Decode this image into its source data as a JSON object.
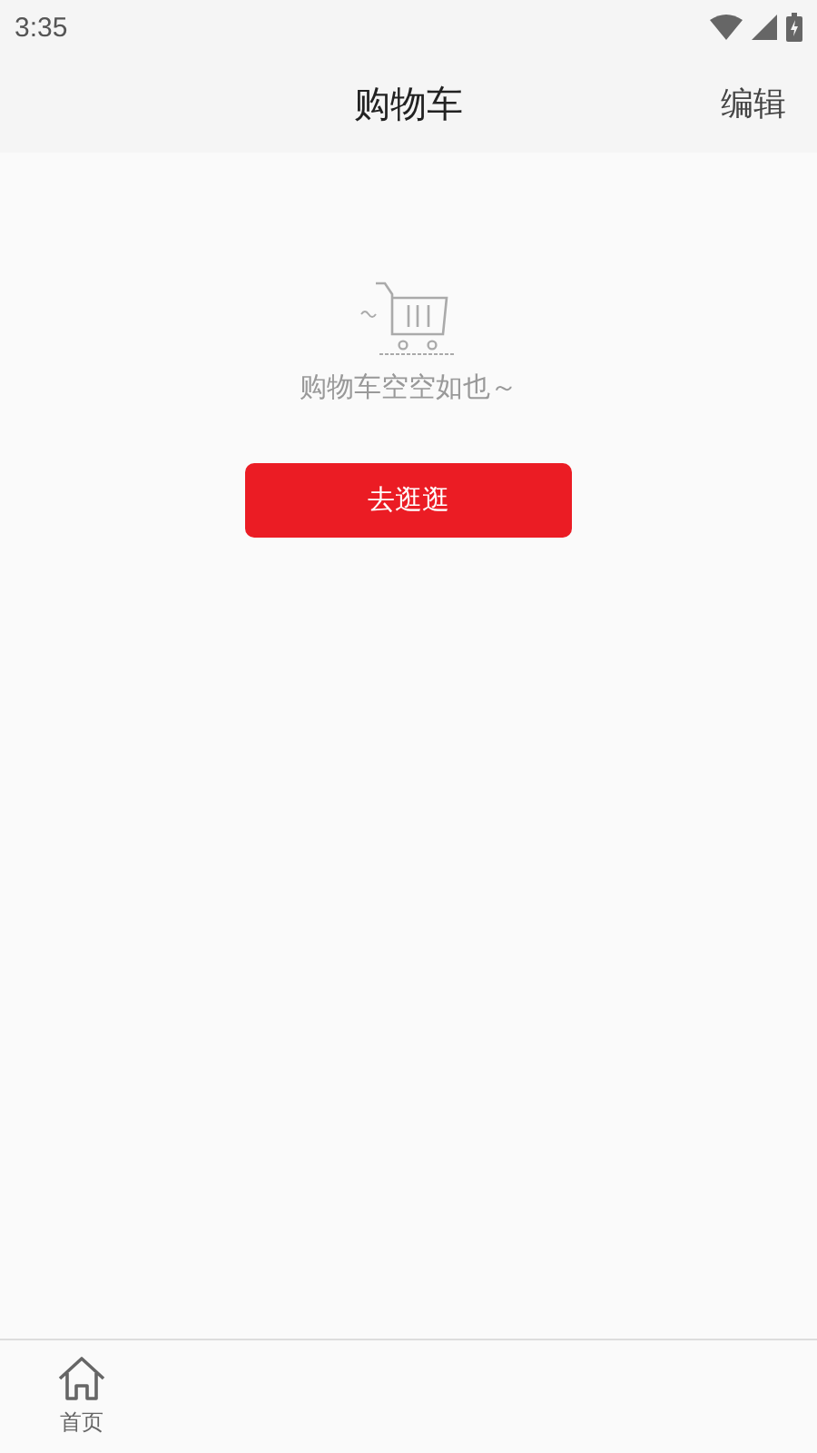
{
  "status_bar": {
    "time": "3:35"
  },
  "header": {
    "title": "购物车",
    "action": "编辑"
  },
  "empty_state": {
    "message": "购物车空空如也～",
    "button": "去逛逛"
  },
  "bottom_nav": [
    {
      "label": "首页",
      "kind": "home",
      "selected": false
    }
  ]
}
